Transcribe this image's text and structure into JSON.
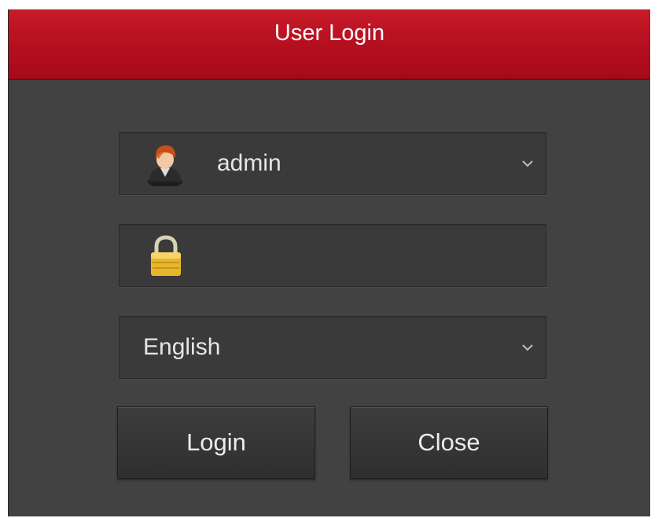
{
  "dialog": {
    "title": "User Login",
    "username": {
      "value": "admin",
      "icon": "user-avatar-icon",
      "dropdown_icon": "chevron-down-icon"
    },
    "password": {
      "value": "",
      "icon": "lock-icon"
    },
    "language": {
      "value": "English",
      "dropdown_icon": "chevron-down-icon"
    },
    "buttons": {
      "login": "Login",
      "close": "Close"
    },
    "colors": {
      "title_bar": "#b40f1f",
      "background": "#424242",
      "lock": "#e8b62a"
    }
  }
}
